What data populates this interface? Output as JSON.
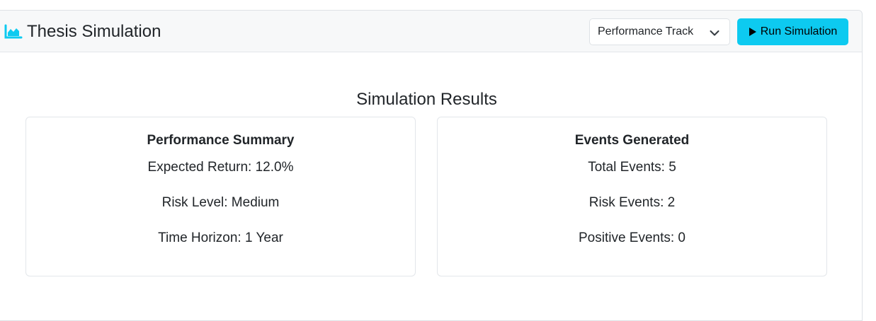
{
  "header": {
    "title": "Thesis Simulation",
    "icon": "area-chart-icon",
    "track_select": {
      "selected": "Performance Track"
    },
    "run_button_label": "Run Simulation"
  },
  "results": {
    "title": "Simulation Results",
    "performance": {
      "title": "Performance Summary",
      "stats": [
        "Expected Return: 12.0%",
        "Risk Level: Medium",
        "Time Horizon: 1 Year"
      ]
    },
    "events": {
      "title": "Events Generated",
      "stats": [
        "Total Events: 5",
        "Risk Events: 2",
        "Positive Events: 0"
      ]
    }
  },
  "colors": {
    "accent": "#0dcaf0",
    "icon": "#0dcaf0",
    "header_bg": "#f7f8f9"
  }
}
